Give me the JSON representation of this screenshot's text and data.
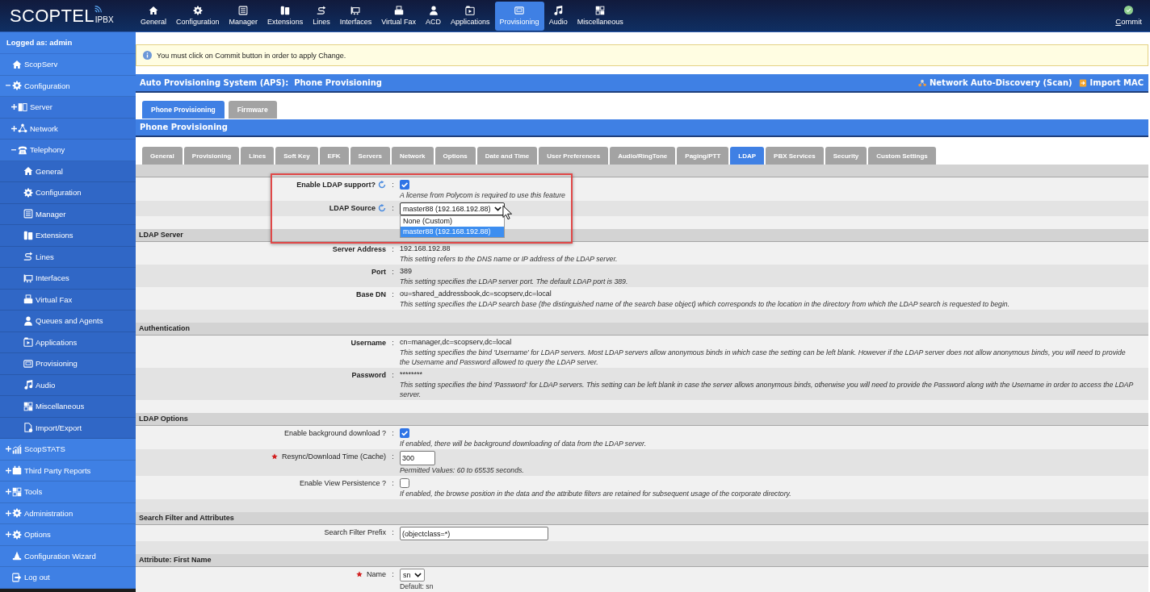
{
  "topbar": {
    "brand": "SCOPTEL",
    "brand_suffix": "IPBX",
    "nav": [
      {
        "label": "General",
        "selected": false
      },
      {
        "label": "Configuration",
        "selected": false
      },
      {
        "label": "Manager",
        "selected": false
      },
      {
        "label": "Extensions",
        "selected": false
      },
      {
        "label": "Lines",
        "selected": false
      },
      {
        "label": "Interfaces",
        "selected": false
      },
      {
        "label": "Virtual Fax",
        "selected": false
      },
      {
        "label": "ACD",
        "selected": false
      },
      {
        "label": "Applications",
        "selected": false
      },
      {
        "label": "Provisioning",
        "selected": true
      },
      {
        "label": "Audio",
        "selected": false
      },
      {
        "label": "Miscellaneous",
        "selected": false
      }
    ],
    "commit": "Commit"
  },
  "sidebar": {
    "user": "Logged as: admin",
    "items": [
      {
        "label": "ScopServ"
      },
      {
        "label": "Configuration",
        "expanded": true,
        "children": [
          {
            "label": "Server",
            "expanded": false
          },
          {
            "label": "Network",
            "expanded": false
          },
          {
            "label": "Telephony",
            "expanded": true,
            "children": [
              {
                "label": "General"
              },
              {
                "label": "Configuration"
              },
              {
                "label": "Manager"
              },
              {
                "label": "Extensions"
              },
              {
                "label": "Lines"
              },
              {
                "label": "Interfaces"
              },
              {
                "label": "Virtual Fax"
              },
              {
                "label": "Queues and Agents"
              },
              {
                "label": "Applications"
              },
              {
                "label": "Provisioning"
              },
              {
                "label": "Audio"
              },
              {
                "label": "Miscellaneous"
              },
              {
                "label": "Import/Export"
              }
            ]
          }
        ]
      },
      {
        "label": "ScopSTATS",
        "expanded": false
      },
      {
        "label": "Third Party Reports",
        "expanded": false
      },
      {
        "label": "Tools",
        "expanded": false
      },
      {
        "label": "Administration",
        "expanded": false
      },
      {
        "label": "Options",
        "expanded": false
      },
      {
        "label": "Configuration Wizard"
      },
      {
        "label": "Log out"
      }
    ]
  },
  "notice": "You must click on Commit button in order to apply Change.",
  "page_header": {
    "title": "Auto Provisioning System (APS):  Phone Provisioning",
    "links": [
      "Network Auto-Discovery (Scan)",
      "Import MAC"
    ]
  },
  "tabs": [
    {
      "label": "Phone Provisioning",
      "selected": true
    },
    {
      "label": "Firmware",
      "selected": false
    }
  ],
  "panel_title": "Phone Provisioning",
  "subtabs": [
    {
      "label": "General",
      "selected": false
    },
    {
      "label": "Provisioning",
      "selected": false
    },
    {
      "label": "Lines",
      "selected": false
    },
    {
      "label": "Soft Key",
      "selected": false
    },
    {
      "label": "EFK",
      "selected": false
    },
    {
      "label": "Servers",
      "selected": false
    },
    {
      "label": "Network",
      "selected": false
    },
    {
      "label": "Options",
      "selected": false
    },
    {
      "label": "Date and Time",
      "selected": false
    },
    {
      "label": "User Preferences",
      "selected": false
    },
    {
      "label": "Audio/RingTone",
      "selected": false
    },
    {
      "label": "Paging/PTT",
      "selected": false
    },
    {
      "label": "LDAP",
      "selected": true
    },
    {
      "label": "PBX Services",
      "selected": false
    },
    {
      "label": "Security",
      "selected": false
    },
    {
      "label": "Custom Settings",
      "selected": false
    }
  ],
  "sections": [
    {
      "fields": [
        {
          "label": "Enable LDAP support?",
          "label_bold": true,
          "required": false,
          "sync_button": true,
          "colon": ":",
          "kind": "checkbox",
          "checked": true,
          "note": "A license from Polycom is required to use this feature",
          "note_italic": true
        },
        {
          "label": "LDAP Source",
          "label_bold": true,
          "required": false,
          "sync_button": true,
          "colon": ":",
          "kind": "select",
          "value": "master88 (192.168.192.88)",
          "open": true,
          "options": [
            {
              "label": "None (Custom)",
              "selected": false
            },
            {
              "label": "master88 (192.168.192.88)",
              "selected": true
            }
          ]
        }
      ]
    },
    {
      "title": "LDAP Server",
      "fields": [
        {
          "label": "Server Address",
          "label_bold": true,
          "required": false,
          "sync_button": false,
          "colon": ":",
          "kind": "text",
          "value": "192.168.192.88",
          "note": "This setting refers to the DNS name or IP address of the LDAP server.",
          "note_italic": true
        },
        {
          "label": "Port",
          "label_bold": true,
          "required": false,
          "sync_button": false,
          "colon": ":",
          "kind": "text",
          "value": "389",
          "note": "This setting specifies the LDAP server port. The default LDAP port is 389.",
          "note_italic": true
        },
        {
          "label": "Base DN",
          "label_bold": true,
          "required": false,
          "sync_button": false,
          "colon": ":",
          "kind": "text",
          "value": "ou=shared_addressbook,dc=scopserv,dc=local",
          "note": "This setting specifies the LDAP search base (the distinguished name of the search base object) which corresponds to the location in the directory from which the LDAP search is requested to begin.",
          "note_italic": true
        }
      ]
    },
    {
      "title": "Authentication",
      "fields": [
        {
          "label": "Username",
          "label_bold": true,
          "required": false,
          "sync_button": false,
          "colon": ":",
          "kind": "text",
          "value": "cn=manager,dc=scopserv,dc=local",
          "note": "This setting specifies the bind 'Username' for LDAP servers. Most LDAP servers allow anonymous binds in which case the setting can be left blank. However if the LDAP server does not allow anonymous binds, you will need to provide the Username and Password allowed to query the LDAP server.",
          "note_italic": true
        },
        {
          "label": "Password",
          "label_bold": true,
          "required": false,
          "sync_button": false,
          "colon": ":",
          "kind": "text",
          "value": "********",
          "note": "This setting specifies the bind 'Password' for LDAP servers. This setting can be left blank in case the server allows anonymous binds, otherwise you will need to provide the Password along with the Username in order to access the LDAP server.",
          "note_italic": true
        }
      ]
    },
    {
      "title": "LDAP Options",
      "fields": [
        {
          "label": "Enable background download ?",
          "label_bold": false,
          "required": false,
          "sync_button": false,
          "colon": ":",
          "kind": "checkbox",
          "checked": true,
          "note": "If enabled, there will be background downloading of data from the LDAP server.",
          "note_italic": true
        },
        {
          "label": "Resync/Download Time (Cache)",
          "label_bold": false,
          "required": true,
          "sync_button": false,
          "colon": ":",
          "kind": "number",
          "value": "300",
          "note": "Permitted Values: 60 to 65535 seconds.",
          "note_italic": true
        },
        {
          "label": "Enable View Persistence ?",
          "label_bold": false,
          "required": false,
          "sync_button": false,
          "colon": ":",
          "kind": "checkbox",
          "checked": false,
          "note": "If enabled, the browse position in the data and the attribute filters are retained for subsequent usage of the corporate directory.",
          "note_italic": true
        }
      ]
    },
    {
      "title": "Search Filter and Attributes",
      "fields": [
        {
          "label": "Search Filter Prefix",
          "label_bold": false,
          "required": false,
          "sync_button": false,
          "colon": ":",
          "kind": "input",
          "value": "(objectclass=*)"
        }
      ]
    },
    {
      "title": "Attribute: First Name",
      "fields": [
        {
          "label": "Name",
          "label_bold": false,
          "required": true,
          "sync_button": false,
          "colon": ":",
          "kind": "select",
          "value": "sn",
          "open": false,
          "note": "Default: sn",
          "note_italic": false
        }
      ]
    }
  ]
}
